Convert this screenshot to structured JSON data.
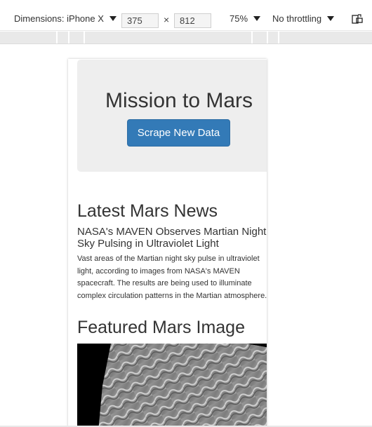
{
  "devtools": {
    "dimensions_label": "Dimensions: iPhone X",
    "width_value": "375",
    "times_sign": "×",
    "height_value": "812",
    "zoom_label": "75%",
    "throttling_label": "No throttling"
  },
  "page": {
    "jumbotron_title": "Mission to Mars",
    "scrape_button_label": "Scrape New Data",
    "news_heading": "Latest Mars News",
    "news_title": "NASA's MAVEN Observes Martian Night Sky Pulsing in Ultraviolet Light",
    "news_paragraph": "Vast areas of the Martian night sky pulse in ultraviolet light, according to images from NASA's MAVEN spacecraft. The results are being used to illuminate complex circulation patterns in the Martian atmosphere.",
    "image_heading": "Featured Mars Image"
  },
  "colors": {
    "button_primary": "#337ab7",
    "jumbotron_bg": "#eeeeee",
    "text": "#333333"
  },
  "icons": {
    "rotate": "rotate-icon",
    "caret": "caret-down-icon"
  }
}
